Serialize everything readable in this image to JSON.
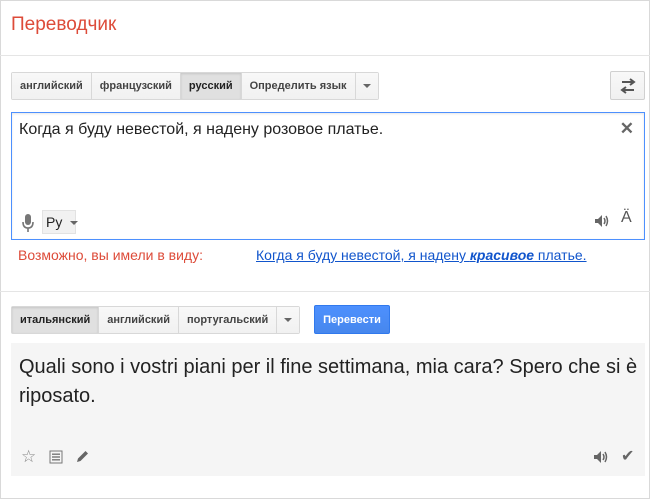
{
  "app": {
    "title": "Переводчик"
  },
  "source": {
    "languages": [
      {
        "label": "английский",
        "selected": false
      },
      {
        "label": "французский",
        "selected": false
      },
      {
        "label": "русский",
        "selected": true
      },
      {
        "label": "Определить язык",
        "selected": false
      }
    ],
    "text": "Когда я буду невестой, я надену розовое платье.",
    "keyboard_lang": "Ру",
    "icons": {
      "clear": "close-icon",
      "mic": "microphone-icon",
      "listen": "speaker-icon",
      "font": "font-icon"
    }
  },
  "suggestion": {
    "prefix": "Возможно, вы имели в виду:",
    "link_before": "Когда я буду невестой, я надену ",
    "link_emph": "красивое",
    "link_after": " платье."
  },
  "target": {
    "languages": [
      {
        "label": "итальянский",
        "selected": true
      },
      {
        "label": "английский",
        "selected": false
      },
      {
        "label": "португальский",
        "selected": false
      }
    ],
    "translate_label": "Перевести",
    "result_text": "Quali sono i vostri piani per il fine settimana, mia cara? Spero che si è riposato."
  },
  "colors": {
    "accent": "#dd4b39",
    "primary_button": "#4d90fe",
    "link": "#1155cc"
  }
}
